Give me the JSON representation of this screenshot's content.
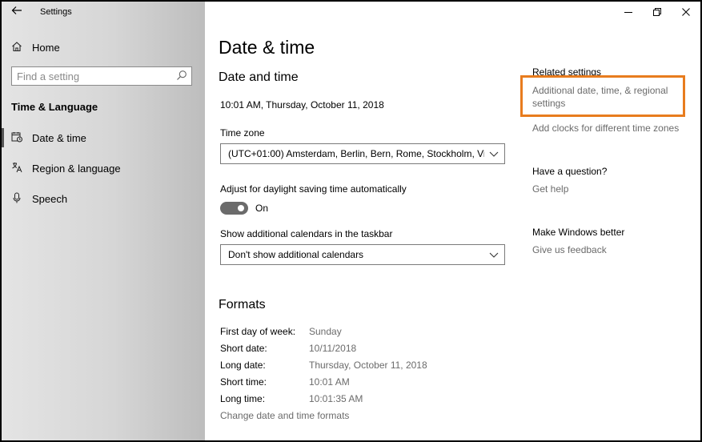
{
  "titlebar": {
    "back_icon": "back-arrow-icon",
    "title": "Settings",
    "minimize_icon": "minimize-icon",
    "restore_icon": "restore-icon",
    "close_icon": "close-icon"
  },
  "sidebar": {
    "home_label": "Home",
    "search_placeholder": "Find a setting",
    "section_title": "Time & Language",
    "items": [
      {
        "label": "Date & time",
        "icon": "calendar-clock-icon",
        "active": true
      },
      {
        "label": "Region & language",
        "icon": "region-language-icon",
        "active": false
      },
      {
        "label": "Speech",
        "icon": "microphone-icon",
        "active": false
      }
    ]
  },
  "main": {
    "page_title": "Date & time",
    "section_title": "Date and time",
    "current_datetime": "10:01 AM, Thursday, October 11, 2018",
    "timezone_label": "Time zone",
    "timezone_value": "(UTC+01:00) Amsterdam, Berlin, Bern, Rome, Stockholm, Vie...",
    "dst_label": "Adjust for daylight saving time automatically",
    "dst_toggle_state": "On",
    "calendars_label": "Show additional calendars in the taskbar",
    "calendars_value": "Don't show additional calendars",
    "formats_title": "Formats",
    "formats": [
      {
        "label": "First day of week:",
        "value": "Sunday"
      },
      {
        "label": "Short date:",
        "value": "10/11/2018"
      },
      {
        "label": "Long date:",
        "value": "Thursday, October 11, 2018"
      },
      {
        "label": "Short time:",
        "value": "10:01 AM"
      },
      {
        "label": "Long time:",
        "value": "10:01:35 AM"
      }
    ],
    "change_formats_link": "Change date and time formats"
  },
  "right": {
    "related_title": "Related settings",
    "regional_link_line1": "Additional date, time, & regional",
    "regional_link_line2": "settings",
    "clocks_link": "Add clocks for different time zones",
    "question_title": "Have a question?",
    "help_link": "Get help",
    "better_title": "Make Windows better",
    "feedback_link": "Give us feedback"
  },
  "colors": {
    "highlight": "#e87c1e",
    "toggle_on": "#6b6b6b",
    "link_gray": "#6b6b6b"
  }
}
